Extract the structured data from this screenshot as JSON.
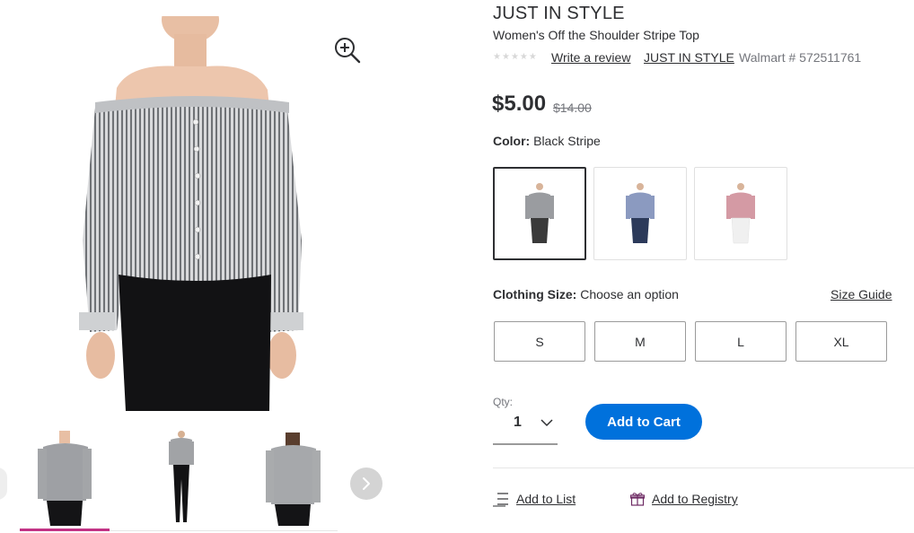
{
  "product": {
    "brand": "JUST IN STYLE",
    "name": "Women's Off the Shoulder Stripe Top",
    "rating_stars": 5,
    "write_review": "Write a review",
    "brand_link": "JUST IN STYLE",
    "walmart_number": "Walmart # 572511761",
    "price": "$5.00",
    "was_price": "$14.00"
  },
  "color": {
    "label": "Color:",
    "value": "Black Stripe",
    "swatches": [
      {
        "name": "Black Stripe",
        "top": "#9a9ca0",
        "bottom": "#3a3a3a",
        "selected": true
      },
      {
        "name": "Blue Stripe",
        "top": "#8b9ac0",
        "bottom": "#2c3a5a",
        "selected": false
      },
      {
        "name": "Red Stripe",
        "top": "#d49aa4",
        "bottom": "#f4f4f4",
        "selected": false
      }
    ]
  },
  "size": {
    "label": "Clothing Size:",
    "prompt": "Choose an option",
    "guide": "Size Guide",
    "options": [
      "S",
      "M",
      "L",
      "XL"
    ]
  },
  "quantity": {
    "label": "Qty:",
    "value": "1"
  },
  "actions": {
    "add_to_cart": "Add to Cart",
    "add_to_list": "Add to List",
    "add_to_registry": "Add to Registry"
  },
  "gallery": {
    "selected_index": 0,
    "thumbnails": [
      "front",
      "full-body",
      "back"
    ]
  },
  "colors": {
    "primary_blue": "#0071dc",
    "thumbnail_accent": "#c23285",
    "registry_icon": "#6d2a63"
  }
}
